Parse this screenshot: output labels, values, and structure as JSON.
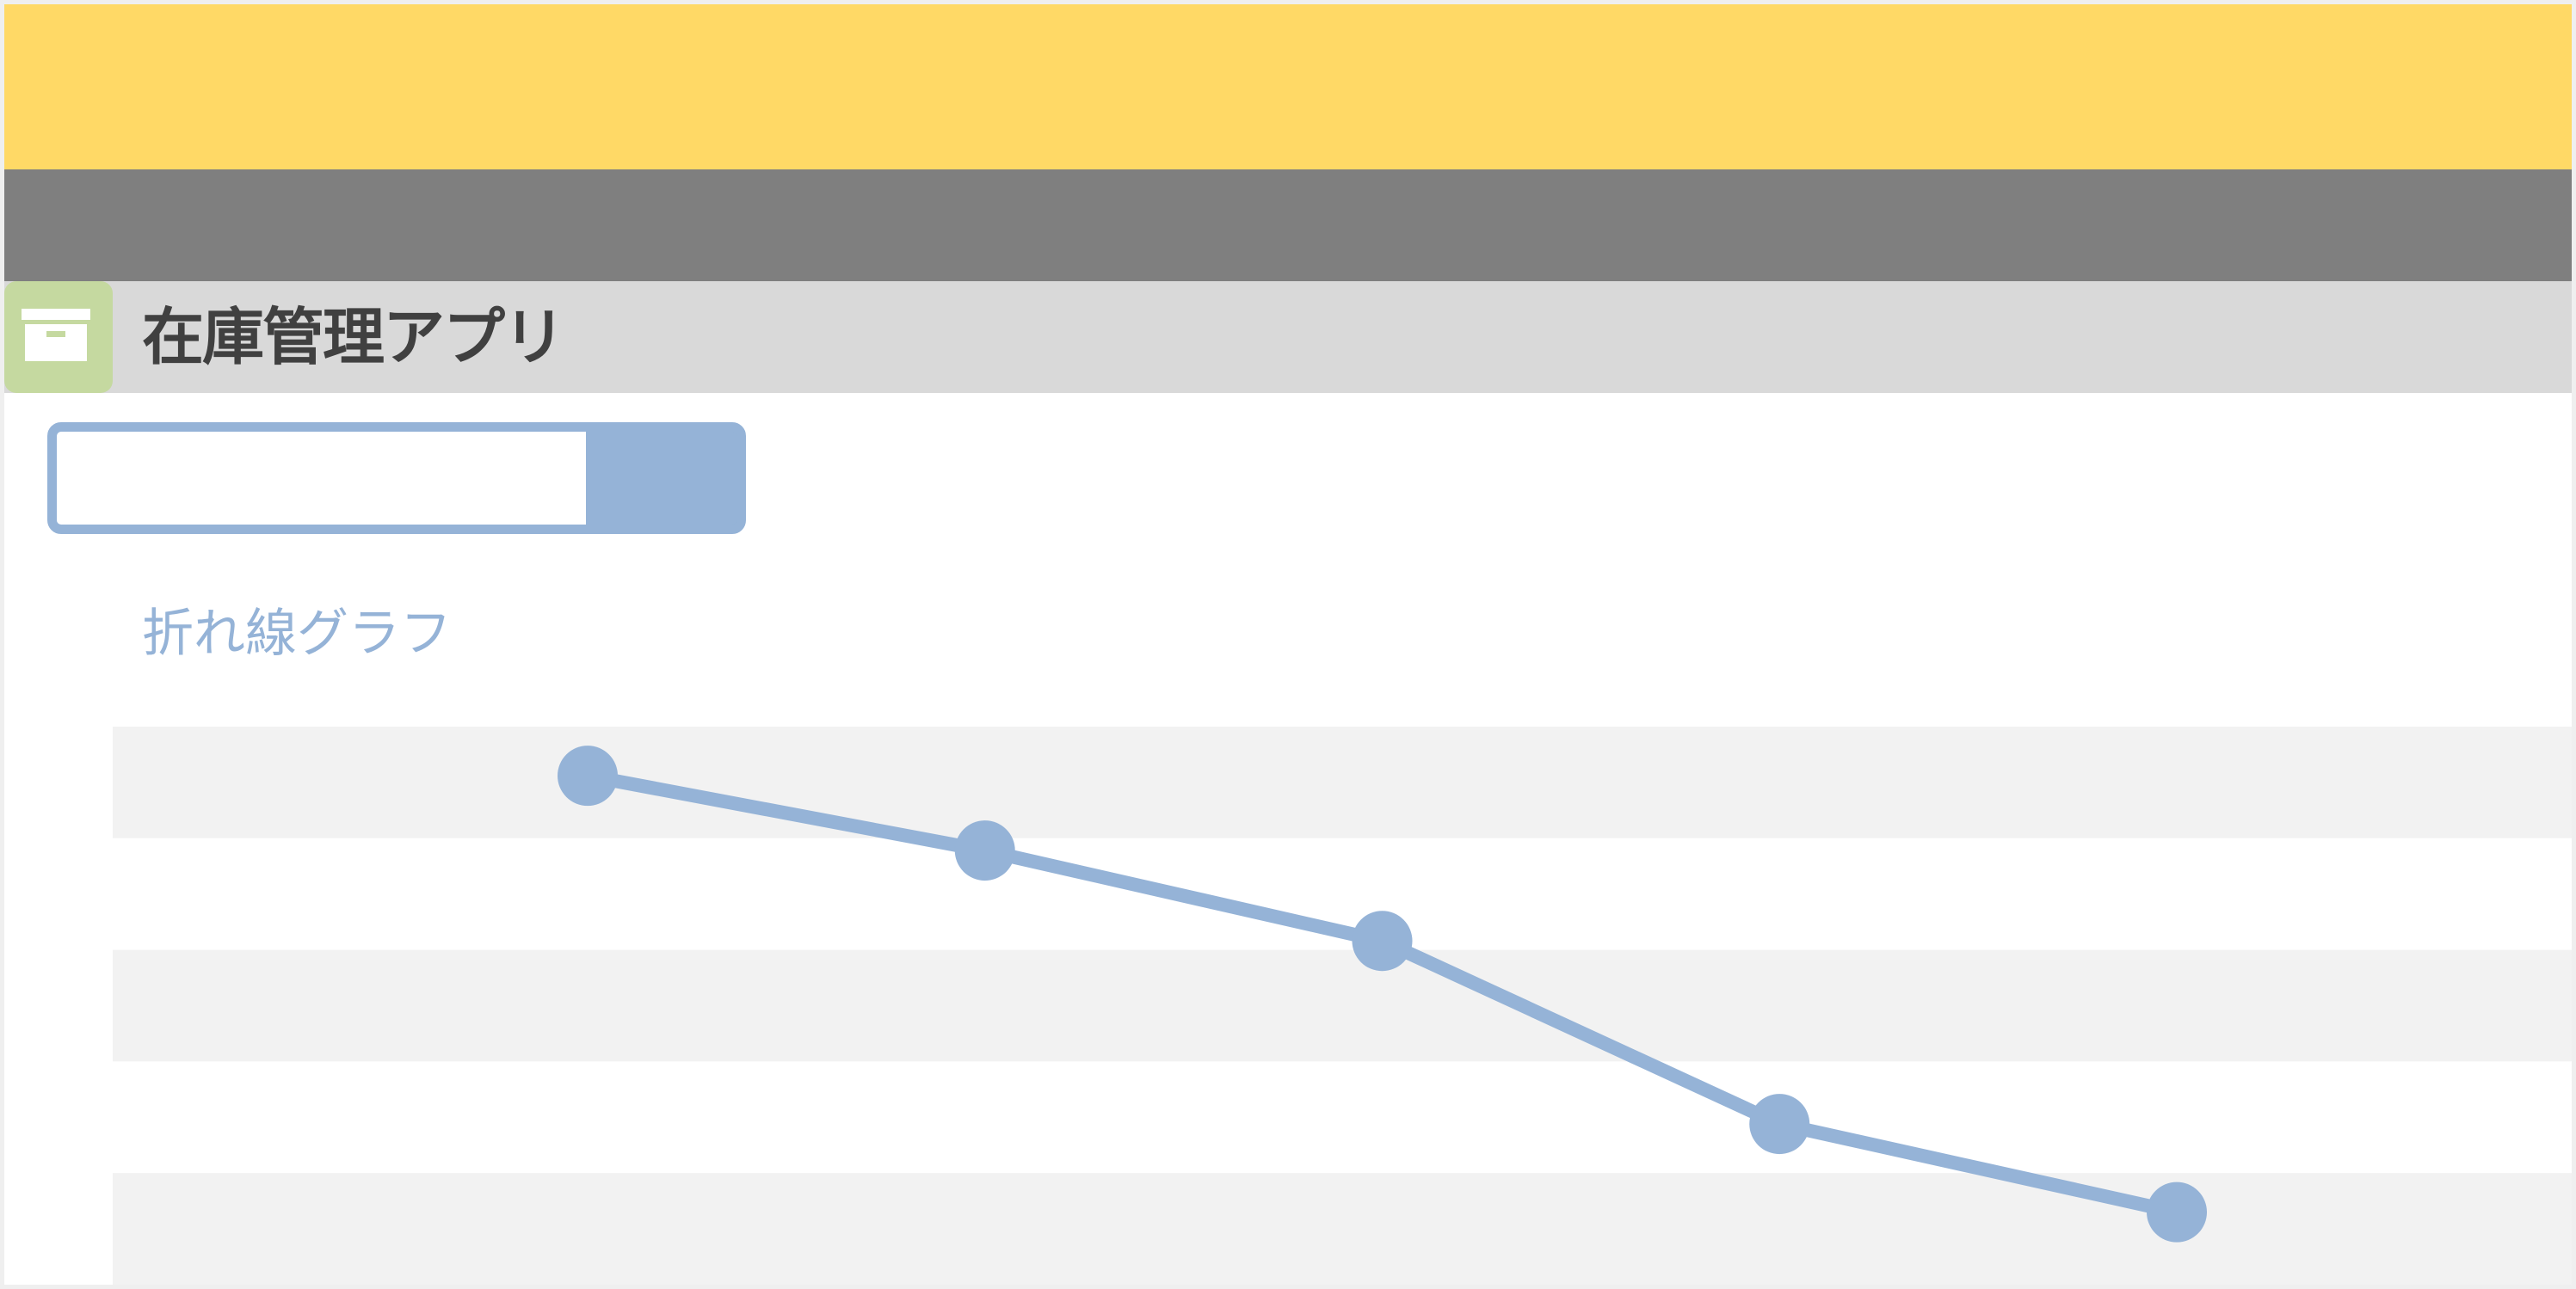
{
  "app": {
    "title": "在庫管理アプリ",
    "icon": "archive-box-icon"
  },
  "search": {
    "value": "",
    "placeholder": ""
  },
  "colors": {
    "header_band": "#ffd966",
    "nav_band": "#7f7f7f",
    "title_bar": "#d9d9d9",
    "icon_tile": "#c5d9a0",
    "accent": "#95b3d7",
    "stripe": "#f2f2f2"
  },
  "chart_data": {
    "type": "line",
    "title": "折れ線グラフ",
    "grid": "horizontal-stripes",
    "ylim": [
      0,
      5
    ],
    "x": [
      1,
      2,
      3,
      4,
      5
    ],
    "series": [
      {
        "values": [
          4.56,
          3.89,
          3.08,
          1.44,
          0.65
        ]
      }
    ]
  }
}
